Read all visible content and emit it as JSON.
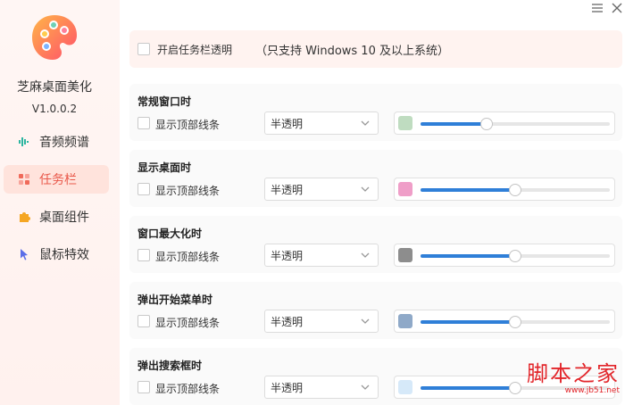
{
  "app": {
    "name": "芝麻桌面美化",
    "version": "V1.0.0.2"
  },
  "window": {
    "menu_icon": "menu-icon",
    "close_icon": "close-icon"
  },
  "sidebar": {
    "items": [
      {
        "label": "音频频谱",
        "icon": "audio-spectrum-icon",
        "active": false
      },
      {
        "label": "任务栏",
        "icon": "taskbar-icon",
        "active": true
      },
      {
        "label": "桌面组件",
        "icon": "puzzle-icon",
        "active": false
      },
      {
        "label": "鼠标特效",
        "icon": "cursor-icon",
        "active": false
      }
    ]
  },
  "top_panel": {
    "checkbox_label": "开启任务栏透明",
    "note": "（只支持 Windows 10 及以上系统）"
  },
  "sections": [
    {
      "title": "常规窗口时",
      "checkbox_label": "显示顶部线条",
      "select_value": "半透明",
      "swatch_color": "#bfdcc0",
      "slider_value": 0.35
    },
    {
      "title": "显示桌面时",
      "checkbox_label": "显示顶部线条",
      "select_value": "半透明",
      "swatch_color": "#ef9ec8",
      "slider_value": 0.5
    },
    {
      "title": "窗口最大化时",
      "checkbox_label": "显示顶部线条",
      "select_value": "半透明",
      "swatch_color": "#8d8d8d",
      "slider_value": 0.5
    },
    {
      "title": "弹出开始菜单时",
      "checkbox_label": "显示顶部线条",
      "select_value": "半透明",
      "swatch_color": "#8fa9c8",
      "slider_value": 0.5
    },
    {
      "title": "弹出搜索框时",
      "checkbox_label": "显示顶部线条",
      "select_value": "半透明",
      "swatch_color": "#d6e9f9",
      "slider_value": 0.5
    }
  ],
  "watermark": {
    "title": "脚本之家",
    "url": "www.jb51.net"
  },
  "colors": {
    "accent": "#e9584a",
    "slider_fill": "#2f7fd8",
    "sidebar_bg": "#fff3f0"
  }
}
